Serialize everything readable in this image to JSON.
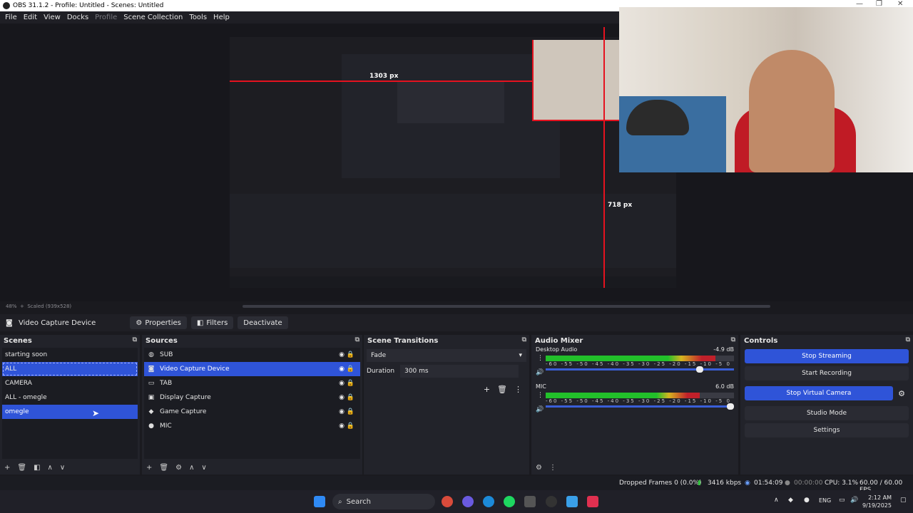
{
  "window": {
    "title": "OBS 31.1.2 - Profile: Untitled - Scenes: Untitled"
  },
  "menu": [
    "File",
    "Edit",
    "View",
    "Docks",
    "Profile",
    "Scene Collection",
    "Tools",
    "Help"
  ],
  "preview": {
    "measure_width": "1303 px",
    "measure_height": "718 px",
    "zoom": "48%",
    "scaled": "Scaled (939x528)"
  },
  "source_bar": {
    "selected_source": "Video Capture Device",
    "properties": "Properties",
    "filters": "Filters",
    "deactivate": "Deactivate"
  },
  "scenes": {
    "title": "Scenes",
    "items": [
      "starting soon",
      "ALL",
      "CAMERA",
      "ALL - omegle",
      "omegle"
    ]
  },
  "sources": {
    "title": "Sources",
    "items": [
      {
        "name": "SUB",
        "icon": "globe-icon"
      },
      {
        "name": "Video Capture Device",
        "icon": "camera-icon"
      },
      {
        "name": "TAB",
        "icon": "window-icon"
      },
      {
        "name": "Display Capture",
        "icon": "monitor-icon"
      },
      {
        "name": "Game Capture",
        "icon": "gamepad-icon"
      },
      {
        "name": "MIC",
        "icon": "mic-icon"
      }
    ]
  },
  "transitions": {
    "title": "Scene Transitions",
    "type": "Fade",
    "duration_label": "Duration",
    "duration_value": "300 ms"
  },
  "mixer": {
    "title": "Audio Mixer",
    "channels": [
      {
        "name": "Desktop Audio",
        "db": "-4.9 dB",
        "level": 0.9,
        "volume": 0.82
      },
      {
        "name": "MIC",
        "db": "6.0 dB",
        "level": 0.82,
        "volume": 0.98
      }
    ],
    "ticks": "-60 -55 -50 -45 -40 -35 -30 -25 -20 -15 -10 -5 0"
  },
  "controls": {
    "title": "Controls",
    "stop_streaming": "Stop Streaming",
    "start_recording": "Start Recording",
    "stop_virtual_camera": "Stop Virtual Camera",
    "studio_mode": "Studio Mode",
    "settings": "Settings"
  },
  "status": {
    "dropped": "Dropped Frames 0 (0.0%)",
    "bitrate": "3416 kbps",
    "stream_time": "01:54:09",
    "rec_time": "00:00:00",
    "cpu": "CPU: 3.1%",
    "fps": "60.00 / 60.00 FPS"
  },
  "taskbar": {
    "search": "Search",
    "lang": "ENG",
    "time": "2:12 AM",
    "date": "9/19/2025"
  },
  "colors": {
    "accent": "#2f54d8",
    "meter_green": "#22c02a",
    "meter_yellow": "#d6b520",
    "meter_red": "#c0202a"
  }
}
